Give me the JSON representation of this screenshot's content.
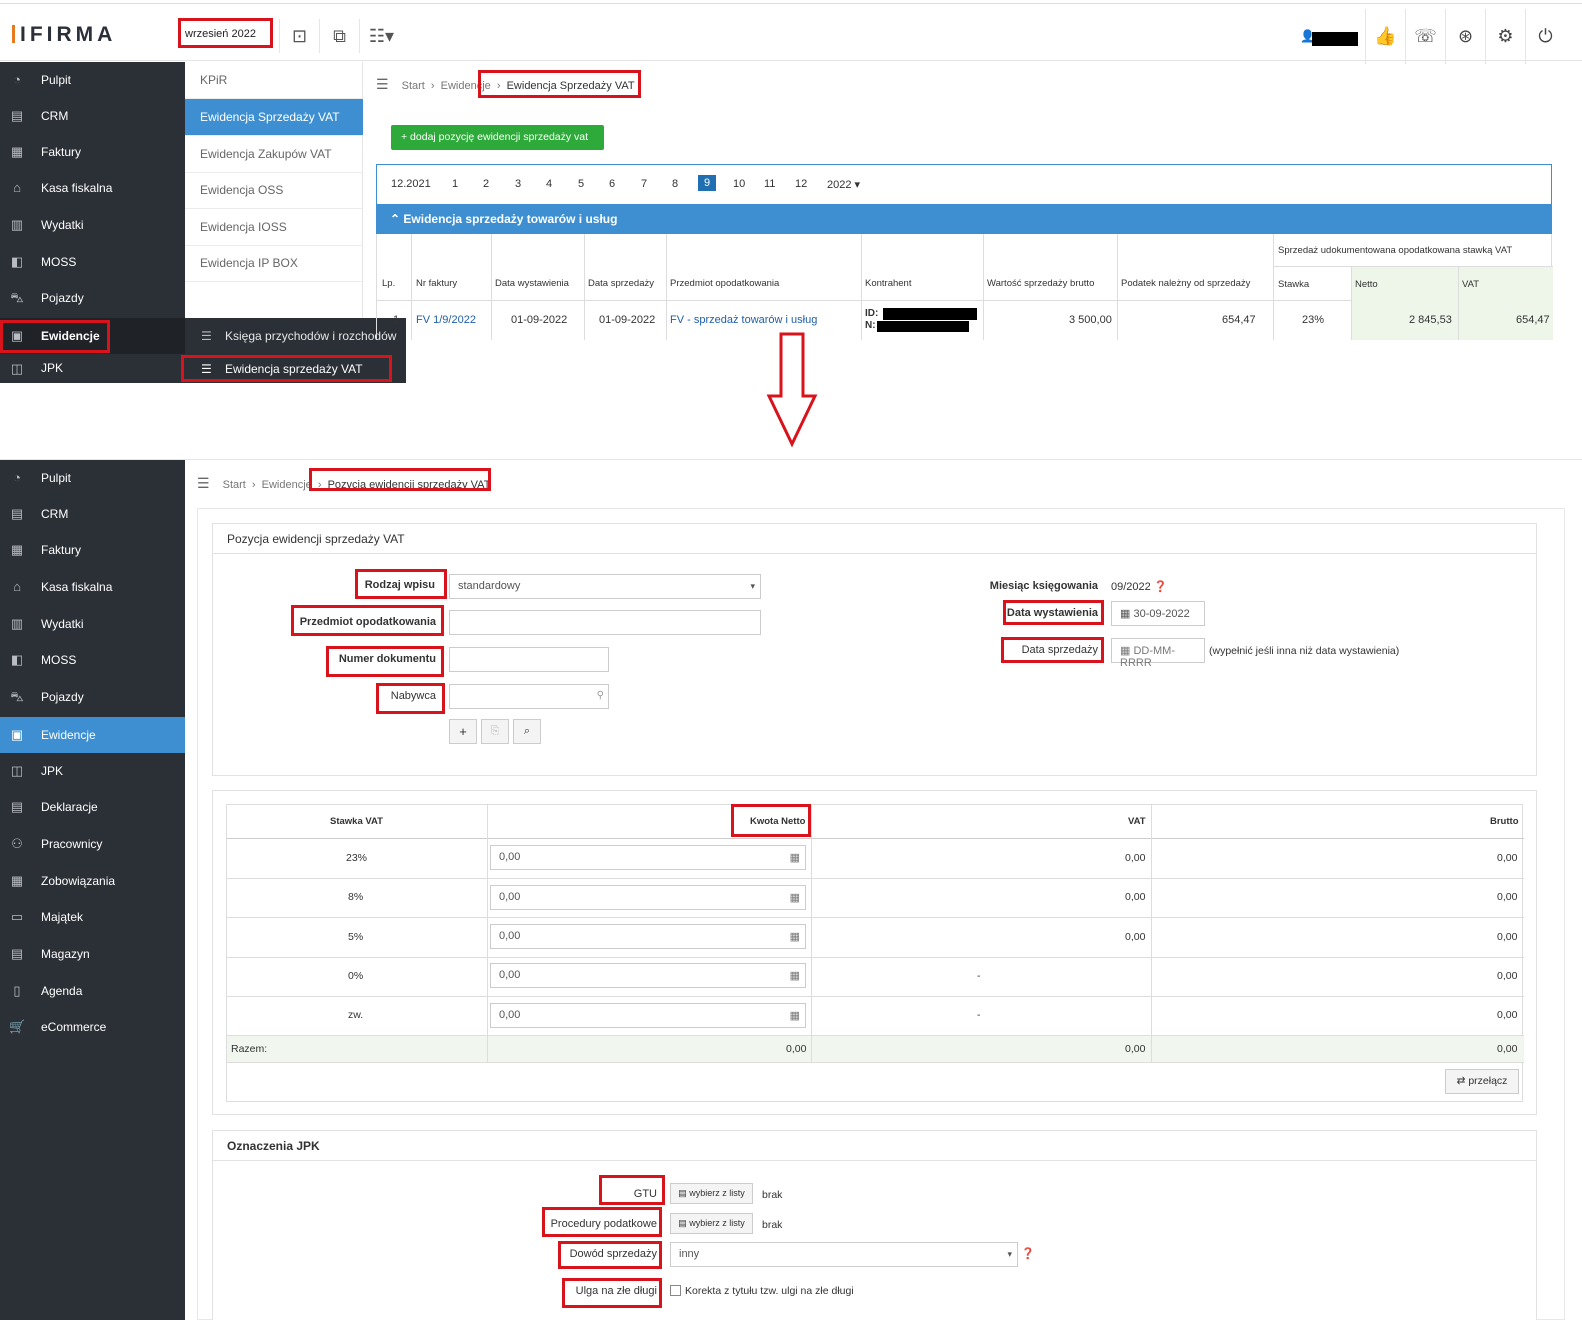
{
  "top": {
    "logo": "IFIRMA",
    "month_picker": "wrzesień 2022",
    "sidebar": [
      "Pulpit",
      "CRM",
      "Faktury",
      "Kasa fiskalna",
      "Wydatki",
      "MOSS",
      "Pojazdy",
      "Ewidencje",
      "JPK"
    ],
    "submenu": [
      "KPiR",
      "Ewidencja Sprzedaży VAT",
      "Ewidencja Zakupów VAT",
      "Ewidencja OSS",
      "Ewidencja IOSS",
      "Ewidencja IP BOX"
    ],
    "flyout": [
      "Księga przychodów i rozchodów",
      "Ewidencja sprzedaży VAT"
    ],
    "breadcrumb": {
      "start": "Start",
      "sep": ">",
      "mid": "Ewidencje",
      "current": "Ewidencja Sprzedaży VAT"
    },
    "add_button": "+ dodaj pozycję ewidencji sprzedaży vat",
    "months": {
      "first": "12.2021",
      "items": [
        "1",
        "2",
        "3",
        "4",
        "5",
        "6",
        "7",
        "8",
        "9",
        "10",
        "11",
        "12"
      ],
      "active": "9",
      "year": "2022"
    },
    "section_title": "Ewidencja sprzedaży towarów i usług",
    "table": {
      "headers": [
        "Lp.",
        "Nr faktury",
        "Data wystawienia",
        "Data sprzedaży",
        "Przedmiot opodatkowania",
        "Kontrahent",
        "Wartość sprzedaży brutto",
        "Podatek należny od sprzedaży"
      ],
      "group_header": "Sprzedaż udokumentowana opodatkowana stawką VAT",
      "sub_headers": [
        "Stawka",
        "Netto",
        "VAT"
      ],
      "row": {
        "lp": "1",
        "nr": "FV 1/9/2022",
        "data_wyst": "01-09-2022",
        "data_sprz": "01-09-2022",
        "przedmiot": "FV - sprzedaż towarów i usług",
        "id_label": "ID:",
        "n_label": "N:",
        "brutto": "3 500,00",
        "podatek": "654,47",
        "stawka": "23%",
        "netto": "2 845,53",
        "vat": "654,47"
      }
    }
  },
  "bottom": {
    "sidebar": [
      "Pulpit",
      "CRM",
      "Faktury",
      "Kasa fiskalna",
      "Wydatki",
      "MOSS",
      "Pojazdy",
      "Ewidencje",
      "JPK",
      "Deklaracje",
      "Pracownicy",
      "Zobowiązania",
      "Majątek",
      "Magazyn",
      "Agenda",
      "eCommerce"
    ],
    "breadcrumb": {
      "start": "Start",
      "mid": "Ewidencje",
      "current": "Pozycja ewidencji sprzedaży VAT"
    },
    "panel_title": "Pozycja ewidencji sprzedaży VAT",
    "form": {
      "rodzaj_label": "Rodzaj wpisu",
      "rodzaj_value": "standardowy",
      "przedmiot_label": "Przedmiot opodatkowania",
      "numer_label": "Numer dokumentu",
      "nabywca_label": "Nabywca",
      "miesiac_label": "Miesiąc księgowania",
      "miesiac_value": "09/2022",
      "data_wyst_label": "Data wystawienia",
      "data_wyst_value": "30-09-2022",
      "data_sprz_label": "Data sprzedaży",
      "data_sprz_placeholder": "DD-MM-RRRR",
      "data_sprz_hint": "(wypełnić jeśli inna niż data wystawienia)"
    },
    "vat_table": {
      "headers": {
        "stawka": "Stawka VAT",
        "netto": "Kwota Netto",
        "vat": "VAT",
        "brutto": "Brutto"
      },
      "rows": [
        {
          "stawka": "23%",
          "netto": "0,00",
          "vat": "0,00",
          "brutto": "0,00"
        },
        {
          "stawka": "8%",
          "netto": "0,00",
          "vat": "0,00",
          "brutto": "0,00"
        },
        {
          "stawka": "5%",
          "netto": "0,00",
          "vat": "0,00",
          "brutto": "0,00"
        },
        {
          "stawka": "0%",
          "netto": "0,00",
          "vat": "-",
          "brutto": "0,00"
        },
        {
          "stawka": "zw.",
          "netto": "0,00",
          "vat": "-",
          "brutto": "0,00"
        }
      ],
      "razem": {
        "label": "Razem:",
        "netto": "0,00",
        "vat": "0,00",
        "brutto": "0,00"
      },
      "toggle_button": "przełącz"
    },
    "jpk": {
      "title": "Oznaczenia JPK",
      "gtu_label": "GTU",
      "gtu_button": "wybierz z listy",
      "gtu_value": "brak",
      "proc_label": "Procedury podatkowe",
      "proc_button": "wybierz z listy",
      "proc_value": "brak",
      "dowod_label": "Dowód sprzedaży",
      "dowod_value": "inny",
      "ulga_label": "Ulga na złe długi",
      "ulga_checkbox": "Korekta z tytułu tzw. ulgi na złe długi"
    }
  },
  "colors": {
    "accent": "#3d8fd1",
    "sidebar": "#2b2f36",
    "green": "#2eaa3a",
    "annotation": "#d9131b"
  }
}
